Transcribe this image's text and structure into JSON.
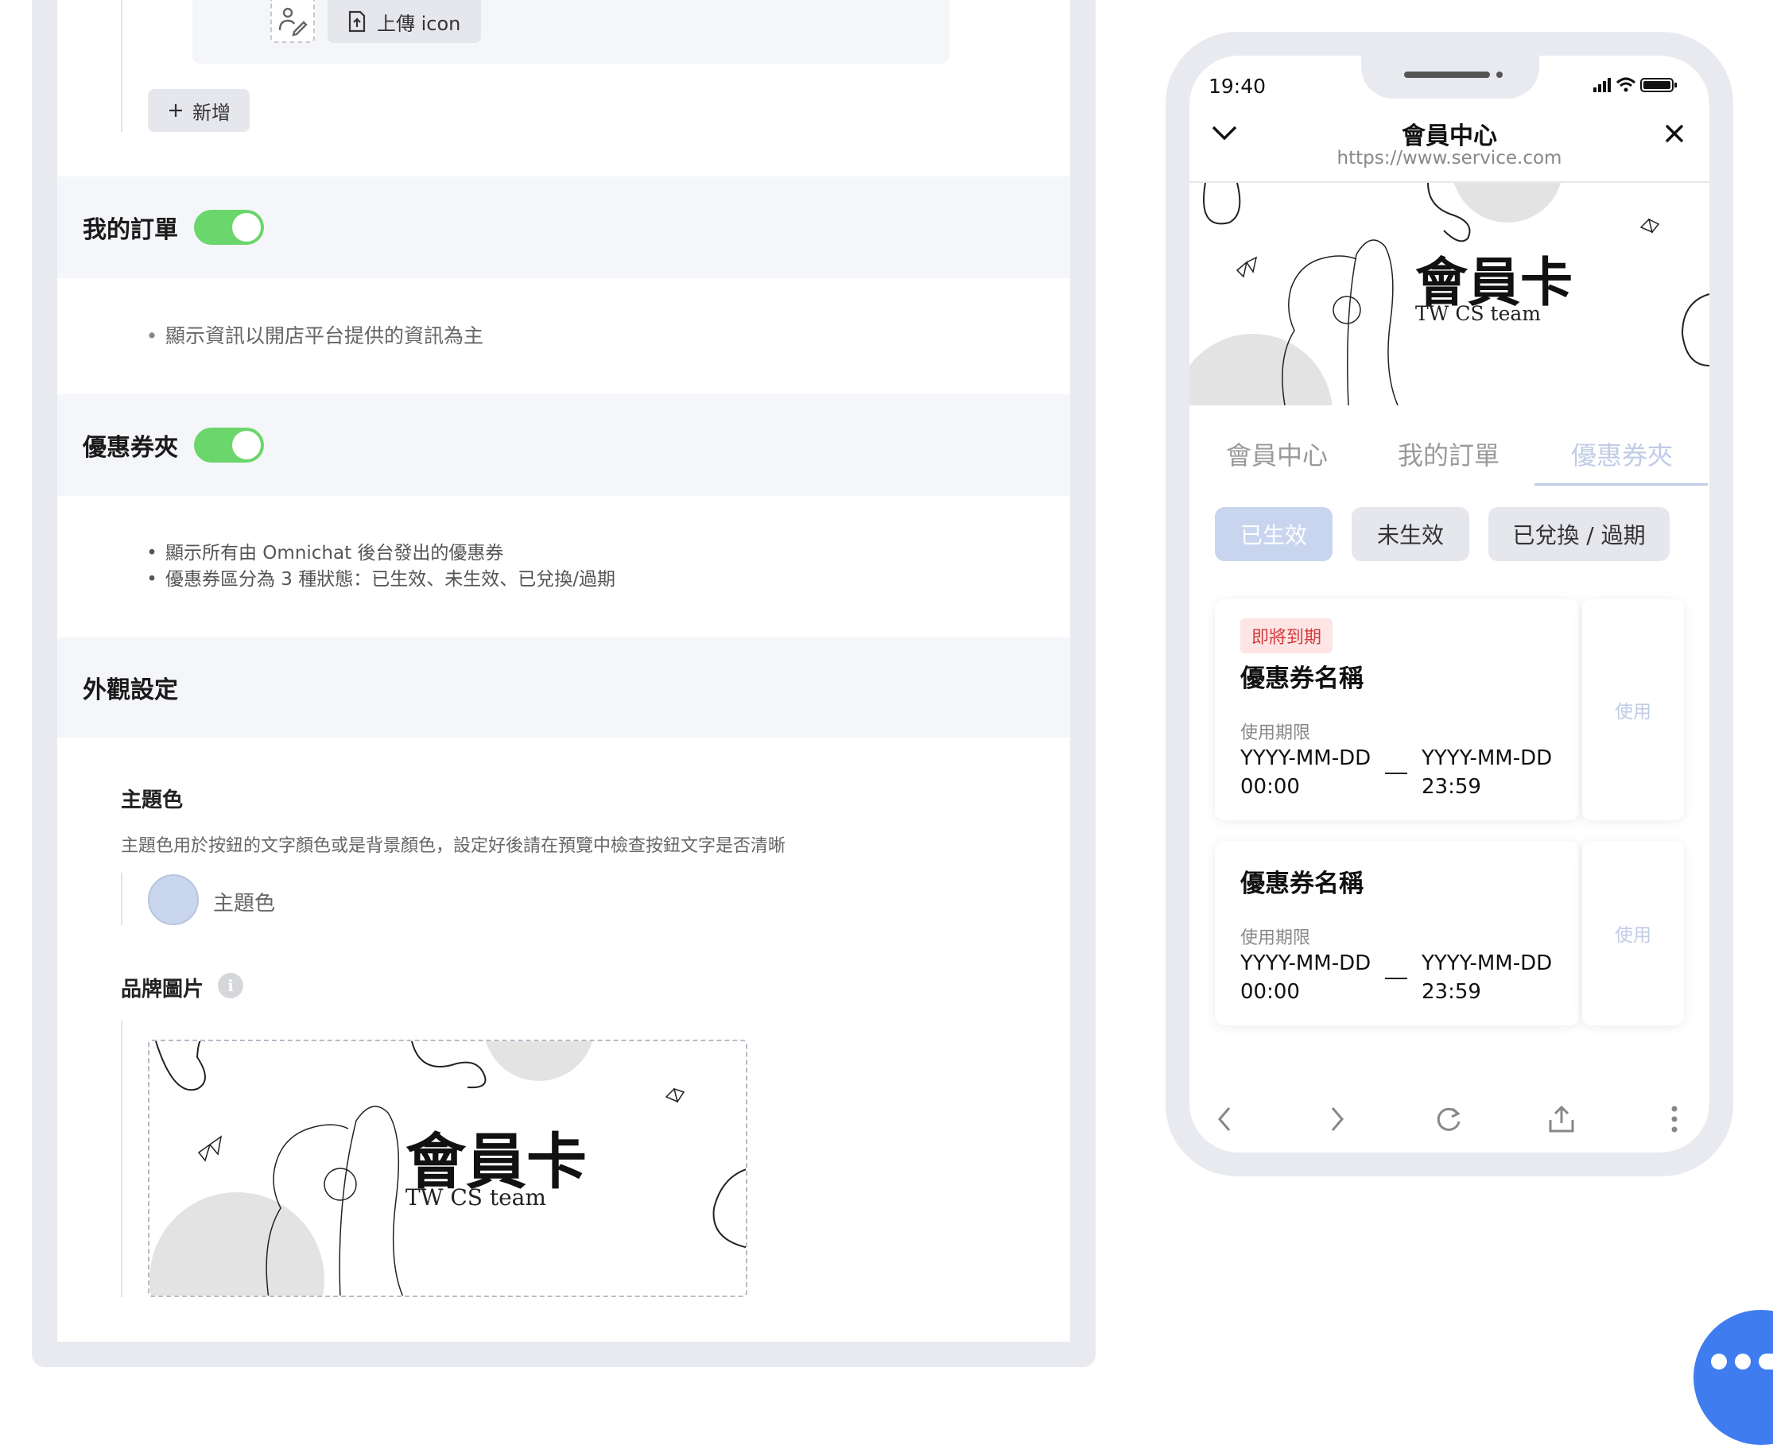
{
  "settings": {
    "upload_icon_label": "上傳 icon",
    "add_button_label": "新增",
    "my_orders": {
      "title": "我的訂單",
      "enabled": true,
      "notes": [
        "顯示資訊以開店平台提供的資訊為主"
      ]
    },
    "coupon_wallet": {
      "title": "優惠券夾",
      "enabled": true,
      "notes": [
        "顯示所有由 Omnichat 後台發出的優惠券",
        "優惠券區分為 3 種狀態：已生效、未生效、已兌換/過期"
      ]
    },
    "appearance": {
      "title": "外觀設定",
      "theme_color_label": "主題色",
      "theme_color_desc": "主題色用於按鈕的文字顏色或是背景顏色，設定好後請在預覽中檢查按鈕文字是否清晰",
      "theme_color_name": "主題色",
      "theme_color_value": "#cad6ee",
      "brand_image_label": "品牌圖片",
      "info_icon_glyph": "i"
    }
  },
  "brand_card": {
    "title": "會員卡",
    "subtitle": "TW CS team"
  },
  "phone": {
    "status_time": "19:40",
    "header_title": "會員中心",
    "header_url": "https://www.service.com",
    "tabs": [
      {
        "label": "會員中心",
        "active": false
      },
      {
        "label": "我的訂單",
        "active": false
      },
      {
        "label": "優惠券夾",
        "active": true
      }
    ],
    "filters": [
      {
        "label": "已生效",
        "active": true
      },
      {
        "label": "未生效",
        "active": false
      },
      {
        "label": "已兌換 / 過期",
        "active": false
      }
    ],
    "coupons": [
      {
        "badge": "即將到期",
        "name": "優惠券名稱",
        "validity_label": "使用期限",
        "start_date": "YYYY-MM-DD",
        "start_time": "00:00",
        "end_date": "YYYY-MM-DD",
        "end_time": "23:59",
        "action": "使用"
      },
      {
        "badge": "",
        "name": "優惠券名稱",
        "validity_label": "使用期限",
        "start_date": "YYYY-MM-DD",
        "start_time": "00:00",
        "end_date": "YYYY-MM-DD",
        "end_time": "23:59",
        "action": "使用"
      }
    ],
    "icons": [
      "chevron-down-icon",
      "close-icon",
      "back-icon",
      "forward-icon",
      "refresh-icon",
      "share-icon",
      "more-icon"
    ]
  },
  "colors": {
    "toggle_on": "#6bd66b",
    "theme": "#cad6ee",
    "badge_text": "#d23b3b",
    "fab": "#3f7cf0"
  }
}
